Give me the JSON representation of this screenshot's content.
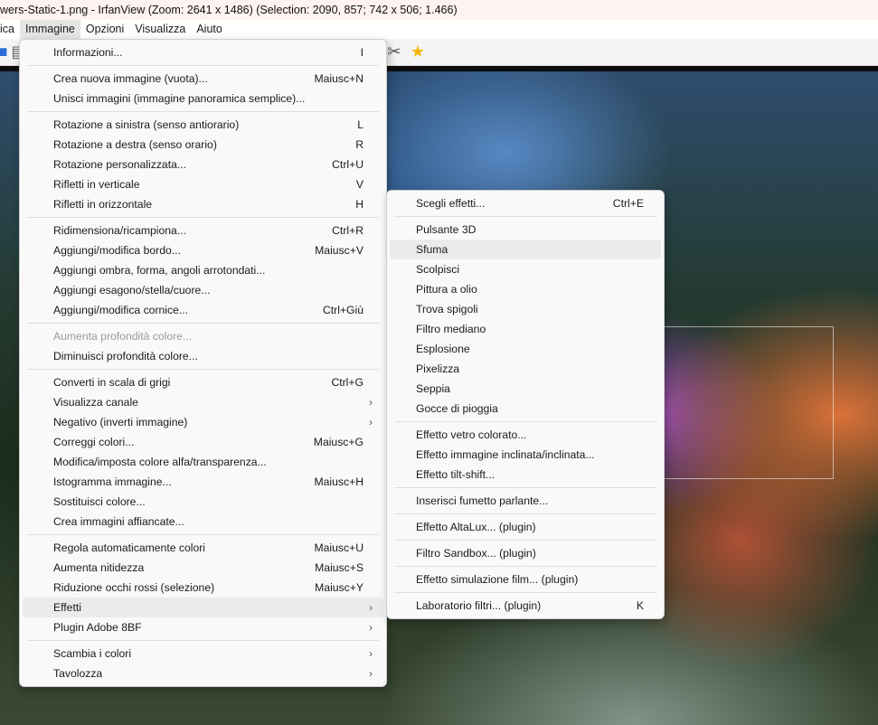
{
  "window": {
    "title": "wers-Static-1.png - IrfanView (Zoom: 2641 x 1486) (Selection: 2090, 857; 742 x 506; 1.466)"
  },
  "menubar": [
    "ica",
    "Immagine",
    "Opzioni",
    "Visualizza",
    "Aiuto"
  ],
  "image_menu": [
    {
      "label": "Informazioni...",
      "shortcut": "I"
    },
    {
      "sep": true
    },
    {
      "label": "Crea nuova immagine (vuota)...",
      "shortcut": "Maiusc+N"
    },
    {
      "label": "Unisci immagini (immagine panoramica semplice)...",
      "shortcut": ""
    },
    {
      "sep": true
    },
    {
      "label": "Rotazione a sinistra (senso antiorario)",
      "shortcut": "L"
    },
    {
      "label": "Rotazione a destra (senso orario)",
      "shortcut": "R"
    },
    {
      "label": "Rotazione personalizzata...",
      "shortcut": "Ctrl+U"
    },
    {
      "label": "Rifletti in verticale",
      "shortcut": "V"
    },
    {
      "label": "Rifletti in orizzontale",
      "shortcut": "H"
    },
    {
      "sep": true
    },
    {
      "label": "Ridimensiona/ricampiona...",
      "shortcut": "Ctrl+R"
    },
    {
      "label": "Aggiungi/modifica bordo...",
      "shortcut": "Maiusc+V"
    },
    {
      "label": "Aggiungi ombra, forma, angoli arrotondati...",
      "shortcut": ""
    },
    {
      "label": "Aggiungi esagono/stella/cuore...",
      "shortcut": ""
    },
    {
      "label": "Aggiungi/modifica cornice...",
      "shortcut": "Ctrl+Giù"
    },
    {
      "sep": true
    },
    {
      "label": "Aumenta profondità colore...",
      "shortcut": "",
      "disabled": true
    },
    {
      "label": "Diminuisci profondità colore...",
      "shortcut": ""
    },
    {
      "sep": true
    },
    {
      "label": "Converti in scala di grigi",
      "shortcut": "Ctrl+G"
    },
    {
      "label": "Visualizza canale",
      "shortcut": "",
      "submenu": true
    },
    {
      "label": "Negativo (inverti immagine)",
      "shortcut": "",
      "submenu": true
    },
    {
      "label": "Correggi colori...",
      "shortcut": "Maiusc+G"
    },
    {
      "label": "Modifica/imposta colore alfa/transparenza...",
      "shortcut": ""
    },
    {
      "label": "Istogramma immagine...",
      "shortcut": "Maiusc+H"
    },
    {
      "label": "Sostituisci colore...",
      "shortcut": ""
    },
    {
      "label": "Crea immagini affiancate...",
      "shortcut": ""
    },
    {
      "sep": true
    },
    {
      "label": "Regola automaticamente colori",
      "shortcut": "Maiusc+U"
    },
    {
      "label": "Aumenta nitidezza",
      "shortcut": "Maiusc+S"
    },
    {
      "label": "Riduzione occhi rossi (selezione)",
      "shortcut": "Maiusc+Y"
    },
    {
      "label": "Effetti",
      "shortcut": "",
      "submenu": true,
      "hover": true
    },
    {
      "label": "Plugin Adobe 8BF",
      "shortcut": "",
      "submenu": true
    },
    {
      "sep": true
    },
    {
      "label": "Scambia i colori",
      "shortcut": "",
      "submenu": true
    },
    {
      "label": "Tavolozza",
      "shortcut": "",
      "submenu": true
    }
  ],
  "effects_menu": [
    {
      "label": "Scegli effetti...",
      "shortcut": "Ctrl+E"
    },
    {
      "sep": true
    },
    {
      "label": "Pulsante 3D",
      "shortcut": ""
    },
    {
      "label": "Sfuma",
      "shortcut": "",
      "hover": true
    },
    {
      "label": "Scolpisci",
      "shortcut": ""
    },
    {
      "label": "Pittura a olio",
      "shortcut": ""
    },
    {
      "label": "Trova spigoli",
      "shortcut": ""
    },
    {
      "label": "Filtro mediano",
      "shortcut": ""
    },
    {
      "label": "Esplosione",
      "shortcut": ""
    },
    {
      "label": "Pixelizza",
      "shortcut": ""
    },
    {
      "label": "Seppia",
      "shortcut": ""
    },
    {
      "label": "Gocce di pioggia",
      "shortcut": ""
    },
    {
      "sep": true
    },
    {
      "label": "Effetto vetro colorato...",
      "shortcut": ""
    },
    {
      "label": "Effetto immagine inclinata/inclinata...",
      "shortcut": ""
    },
    {
      "label": "Effetto tilt-shift...",
      "shortcut": ""
    },
    {
      "sep": true
    },
    {
      "label": "Inserisci fumetto parlante...",
      "shortcut": ""
    },
    {
      "sep": true
    },
    {
      "label": "Effetto AltaLux... (plugin)",
      "shortcut": ""
    },
    {
      "sep": true
    },
    {
      "label": "Filtro Sandbox... (plugin)",
      "shortcut": ""
    },
    {
      "sep": true
    },
    {
      "label": "Effetto simulazione film... (plugin)",
      "shortcut": ""
    },
    {
      "sep": true
    },
    {
      "label": "Laboratorio filtri... (plugin)",
      "shortcut": "K"
    }
  ],
  "icons": {
    "toolbar": [
      "save-icon",
      "print-icon",
      "tools-icon",
      "star-icon"
    ],
    "submenu_arrow": "›"
  },
  "colors": {
    "menu_bg": "#f9f9f9",
    "hover_bg": "#ebebeb",
    "disabled_text": "#9b9b9b",
    "title_bg": "#fff3f1"
  }
}
